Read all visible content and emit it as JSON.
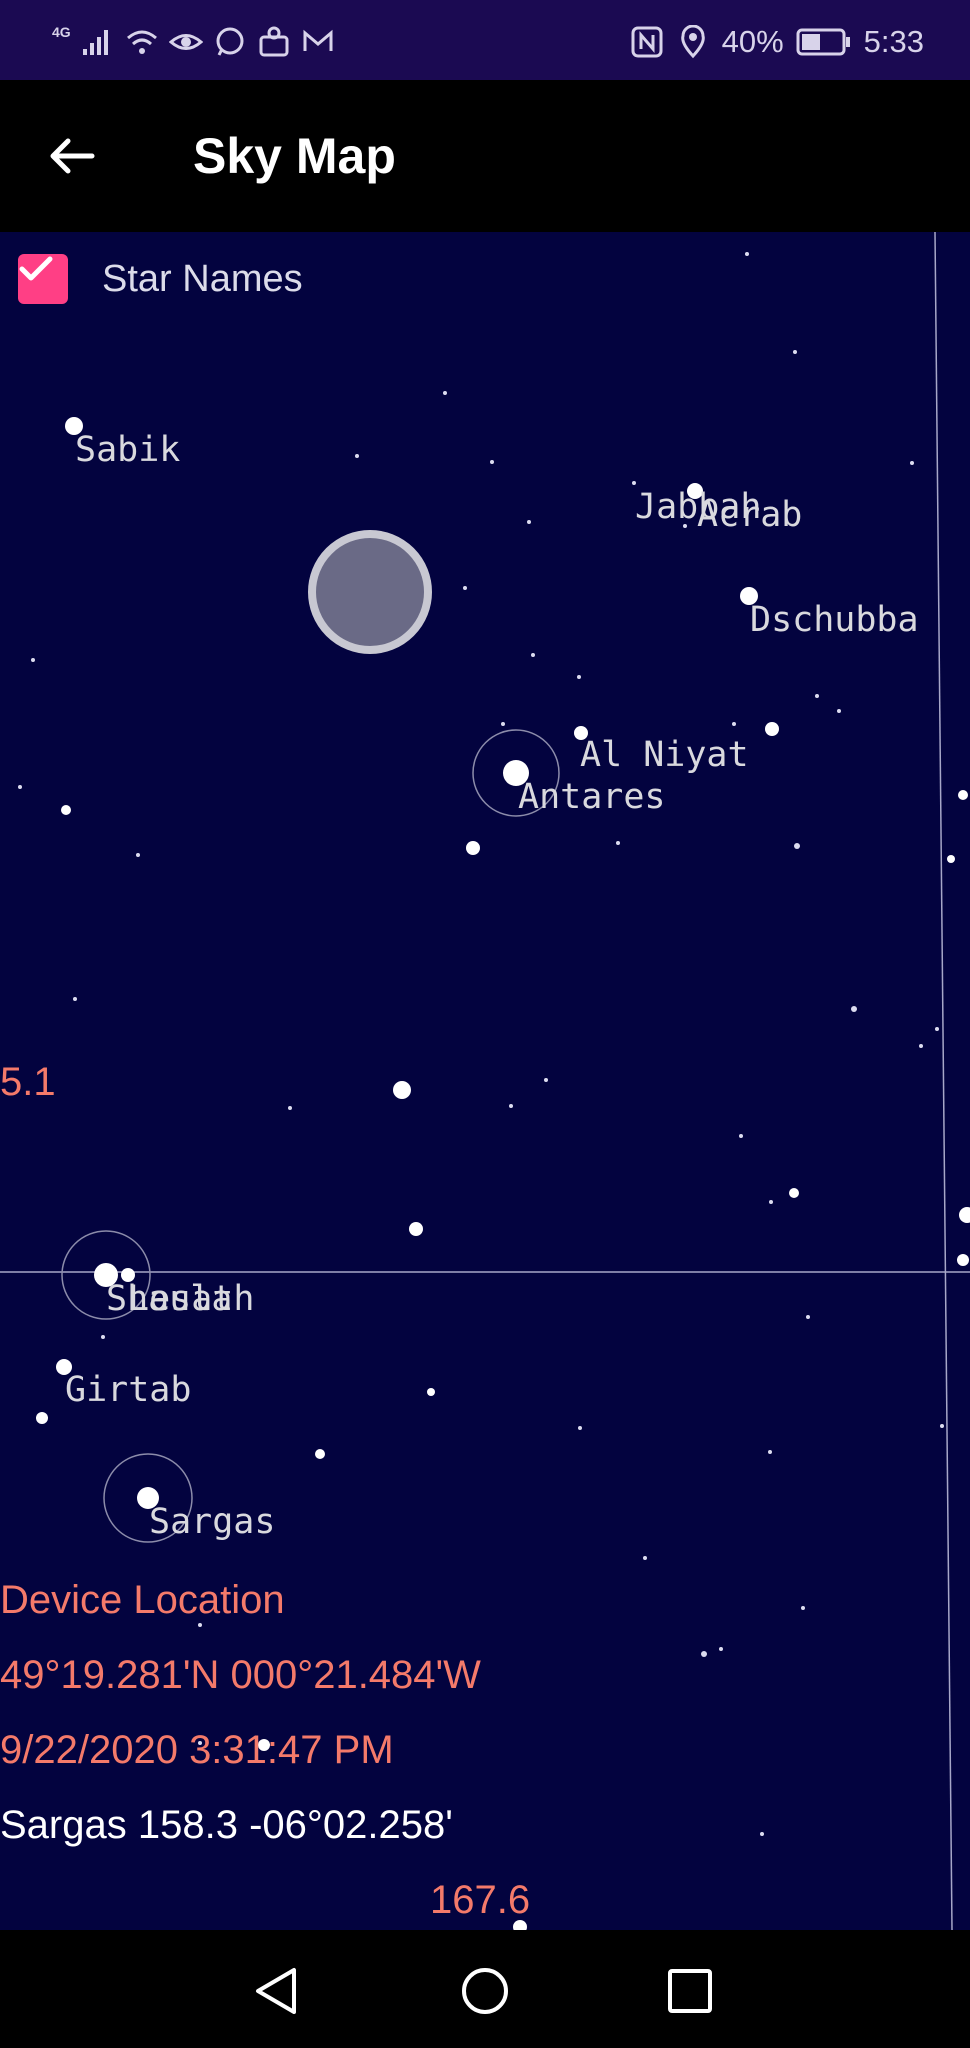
{
  "status_bar": {
    "network": "4G",
    "battery": "40%",
    "time": "5:33"
  },
  "app_bar": {
    "title": "Sky Map"
  },
  "star_names_toggle": {
    "label": "Star Names",
    "checked": true
  },
  "star_labels": [
    "Sabik",
    "Jabbah",
    "Acrab",
    "Dschubba",
    "Al Niyat",
    "Antares",
    "Shaula",
    "Lesath",
    "Girtab",
    "Sargas"
  ],
  "overlay": {
    "edge_value_left": "5.1",
    "device_location_label": "Device Location",
    "coordinates": "49°19.281'N 000°21.484'W",
    "datetime": "9/22/2020 3:31:47 PM",
    "selected_star": "Sargas 158.3 -06°02.258'",
    "edge_value_bottom": "167.6"
  },
  "colors": {
    "status_bar": "#1b0a52",
    "sky": "#03033f",
    "accent_checkbox": "#ff3f85",
    "overlay_text": "#f47a6a"
  }
}
